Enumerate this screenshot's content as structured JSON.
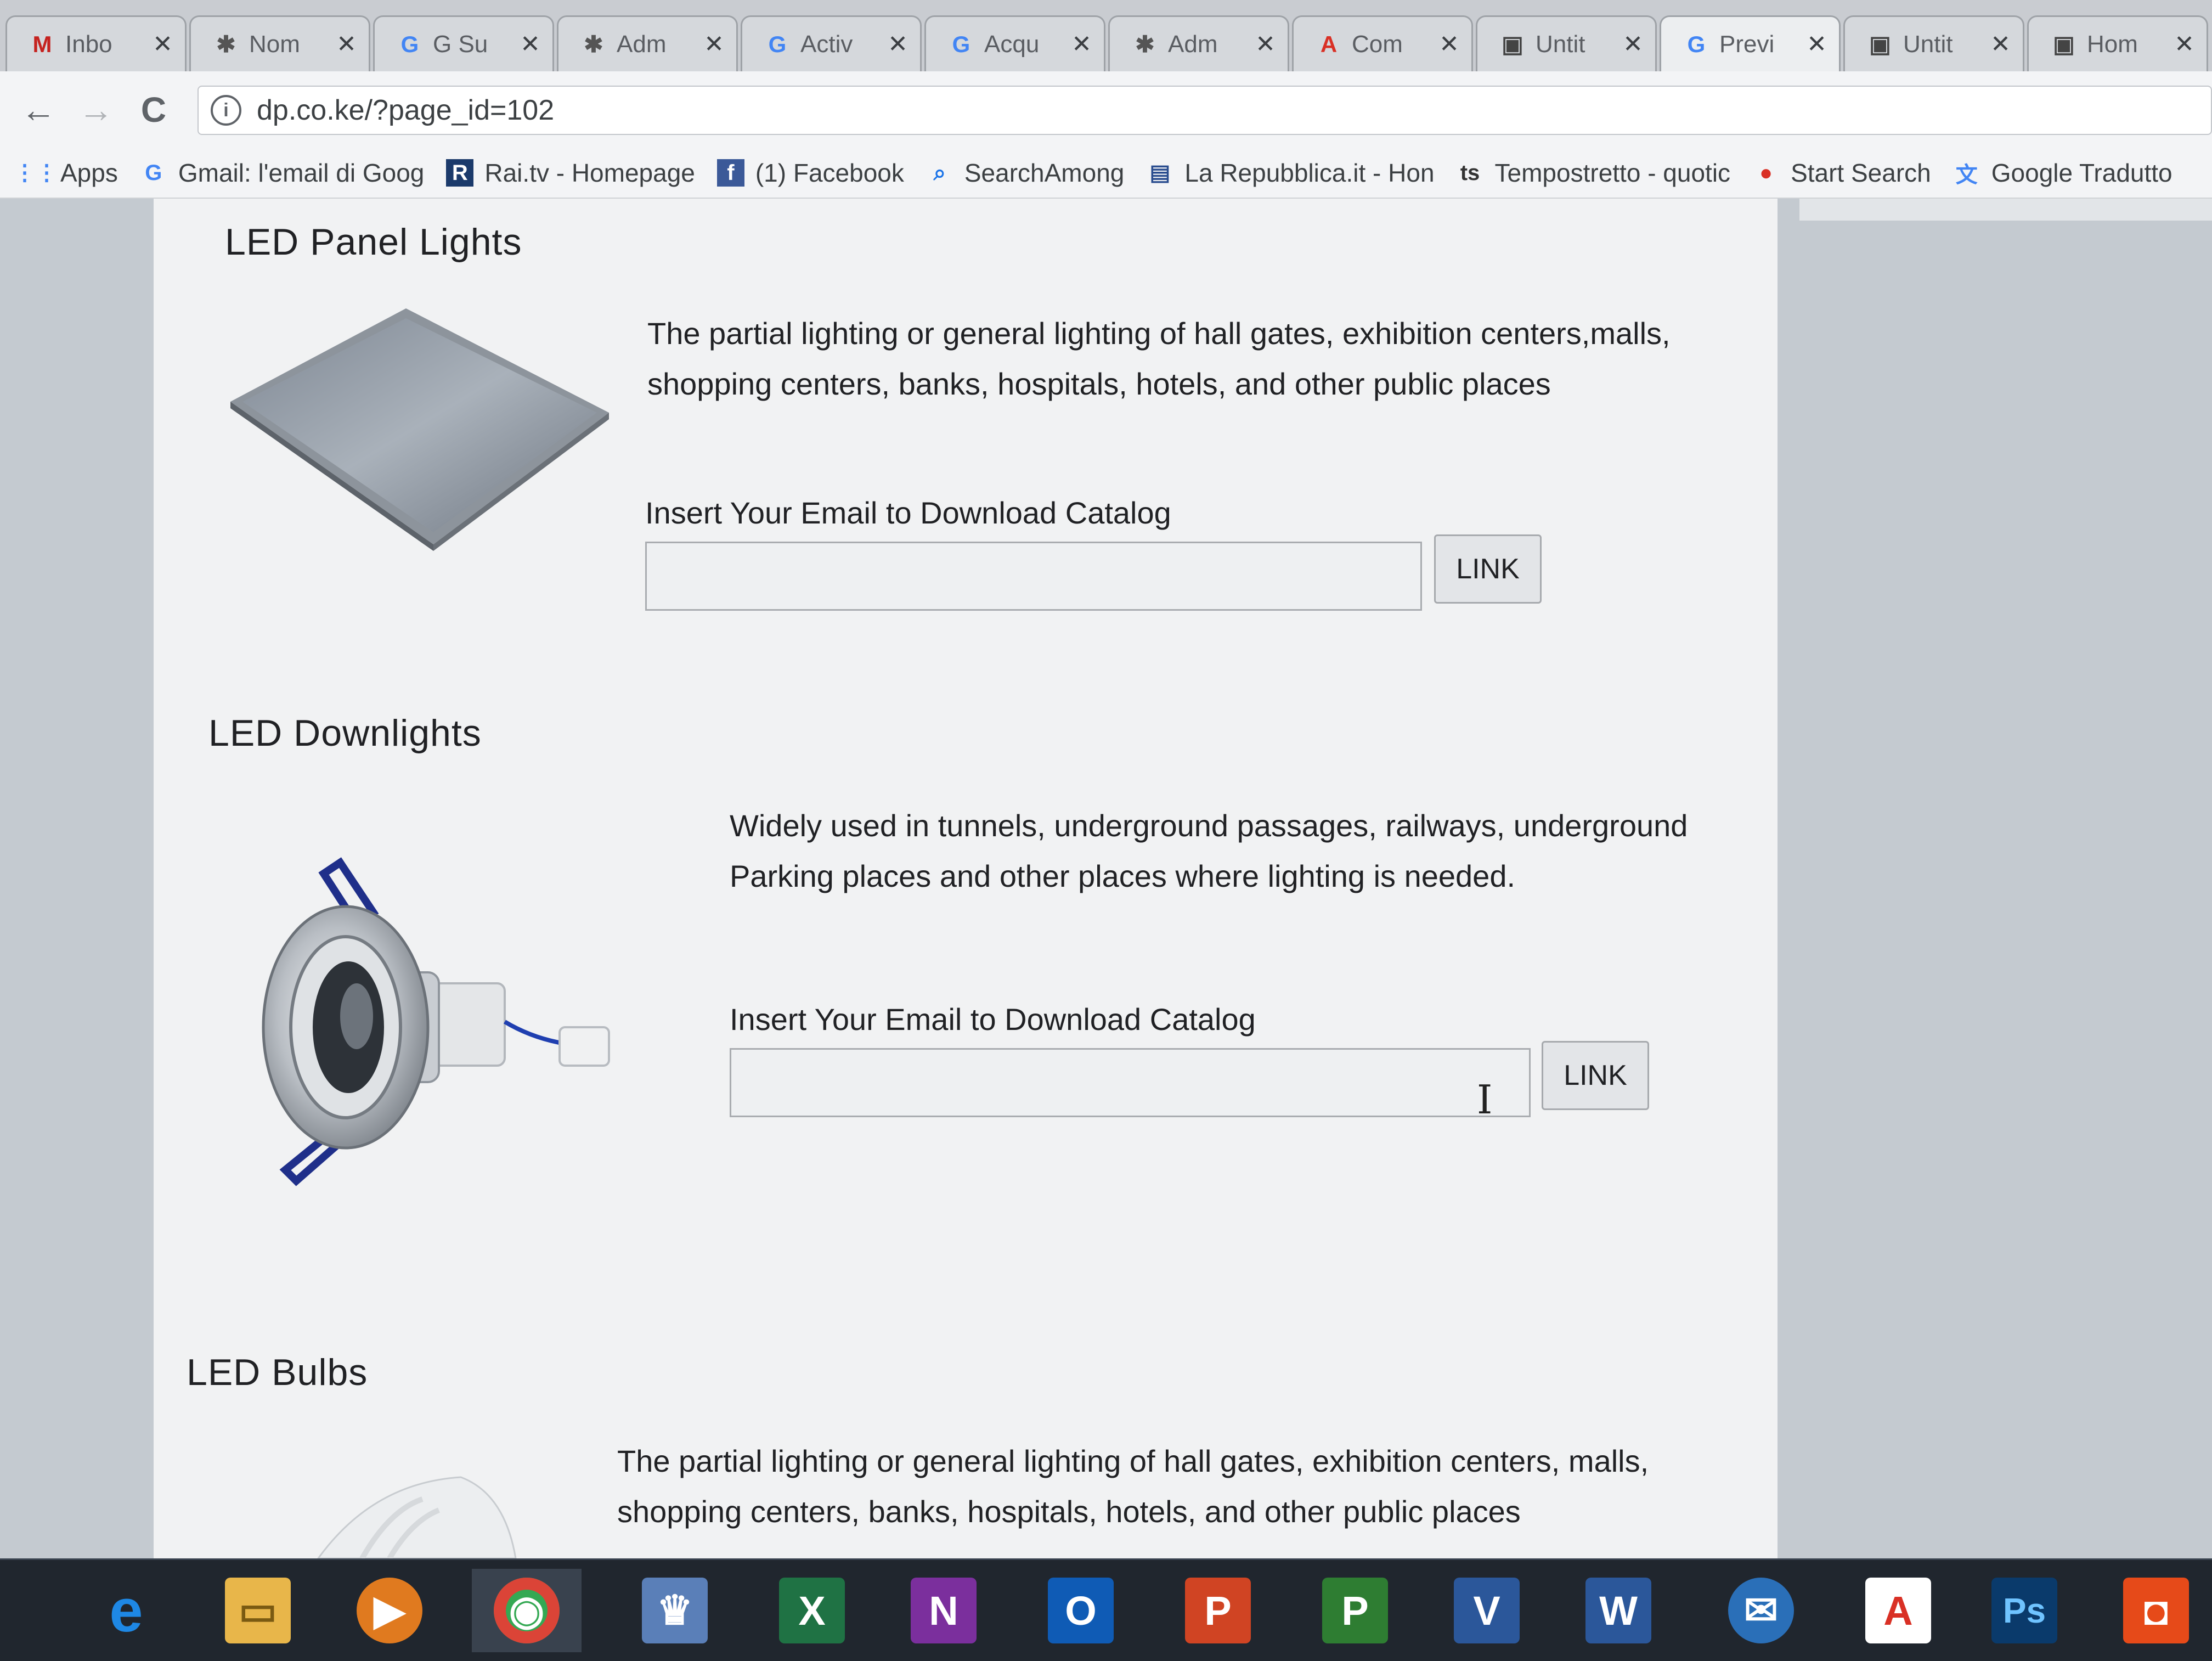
{
  "browser": {
    "tabs": [
      {
        "title": "Inbo",
        "icon": "gmail-icon",
        "glyph": "M",
        "color": "#c5221f"
      },
      {
        "title": "Nom",
        "icon": "plugin-icon",
        "glyph": "✱",
        "color": "#555555"
      },
      {
        "title": "G Su",
        "icon": "google-icon",
        "glyph": "G",
        "color": "#4285f4"
      },
      {
        "title": "Adm",
        "icon": "plugin-icon",
        "glyph": "✱",
        "color": "#555555"
      },
      {
        "title": "Activ",
        "icon": "google-icon",
        "glyph": "G",
        "color": "#4285f4"
      },
      {
        "title": "Acqu",
        "icon": "google-icon",
        "glyph": "G",
        "color": "#4285f4"
      },
      {
        "title": "Adm",
        "icon": "plugin-icon",
        "glyph": "✱",
        "color": "#555555"
      },
      {
        "title": "Com",
        "icon": "acrobat-icon",
        "glyph": "A",
        "color": "#d93025"
      },
      {
        "title": "Untit",
        "icon": "page-icon",
        "glyph": "▣",
        "color": "#444444"
      },
      {
        "title": "Previ",
        "icon": "google-icon",
        "glyph": "G",
        "color": "#4285f4"
      },
      {
        "title": "Untit",
        "icon": "page-icon",
        "glyph": "▣",
        "color": "#444444"
      },
      {
        "title": "Hom",
        "icon": "page-icon",
        "glyph": "▣",
        "color": "#444444"
      }
    ],
    "tab_close": "✕",
    "nav": {
      "back": "←",
      "forward": "→",
      "reload": "C"
    },
    "url": "dp.co.ke/?page_id=102",
    "bookmarks": [
      {
        "label": "Apps",
        "icon": "apps-grid-icon",
        "glyph": "⋮⋮",
        "color": "#4285f4"
      },
      {
        "label": "Gmail: l'email di Goog",
        "icon": "google-icon",
        "glyph": "G",
        "color": "#4285f4"
      },
      {
        "label": "Rai.tv - Homepage",
        "icon": "rai-icon",
        "glyph": "R",
        "color": "#1b3a6b"
      },
      {
        "label": "(1) Facebook",
        "icon": "facebook-icon",
        "glyph": "f",
        "color": "#3b5998"
      },
      {
        "label": "SearchAmong",
        "icon": "magnifier-icon",
        "glyph": "⌕",
        "color": "#1a73e8"
      },
      {
        "label": "La Repubblica.it - Hon",
        "icon": "newspaper-icon",
        "glyph": "▤",
        "color": "#2a4d8f"
      },
      {
        "label": "Tempostretto - quotic",
        "icon": "ts-icon",
        "glyph": "ts",
        "color": "#333333"
      },
      {
        "label": "Start Search",
        "icon": "search-bubble-icon",
        "glyph": "●",
        "color": "#d93025"
      },
      {
        "label": "Google Tradutto",
        "icon": "translate-icon",
        "glyph": "文",
        "color": "#4285f4"
      }
    ]
  },
  "page": {
    "sections": [
      {
        "title": "LED Panel Lights",
        "description": [
          "The partial lighting or general lighting of hall gates, exhibition centers,malls,",
          "shopping centers, banks, hospitals, hotels, and other public places"
        ],
        "email_label": "Insert Your Email to Download Catalog",
        "button": "LINK"
      },
      {
        "title": "LED Downlights",
        "description": [
          "Widely used in tunnels, underground passages, railways, underground",
          "Parking places and other places where lighting is needed."
        ],
        "email_label": "Insert Your Email to Download Catalog",
        "button": "LINK"
      },
      {
        "title": "LED Bulbs",
        "description": [
          "The partial lighting or general lighting of hall gates, exhibition centers, malls,",
          "shopping centers, banks, hospitals, hotels, and other public places"
        ]
      }
    ]
  },
  "taskbar": {
    "apps": [
      {
        "name": "Internet Explorer",
        "icon": "ie-icon",
        "glyph": "e",
        "color": "#1e88e5"
      },
      {
        "name": "File Explorer",
        "icon": "folder-icon",
        "glyph": "▭",
        "color": "#e8b64a"
      },
      {
        "name": "Media Player",
        "icon": "media-player-icon",
        "glyph": "▶",
        "color": "#e07a1f"
      },
      {
        "name": "Chrome",
        "icon": "chrome-icon",
        "glyph": "◉",
        "color": "#34a853"
      },
      {
        "name": "Store",
        "icon": "store-icon",
        "glyph": "♛",
        "color": "#5a7fb8"
      },
      {
        "name": "Excel",
        "icon": "excel-icon",
        "glyph": "X",
        "color": "#1f7244"
      },
      {
        "name": "OneNote",
        "icon": "onenote-icon",
        "glyph": "N",
        "color": "#7b2f9d"
      },
      {
        "name": "Outlook",
        "icon": "outlook-icon",
        "glyph": "O",
        "color": "#0f5bb5"
      },
      {
        "name": "PowerPoint",
        "icon": "powerpoint-icon",
        "glyph": "P",
        "color": "#d04423"
      },
      {
        "name": "Project",
        "icon": "project-icon",
        "glyph": "P",
        "color": "#2e7d32"
      },
      {
        "name": "Visio",
        "icon": "visio-icon",
        "glyph": "V",
        "color": "#2b579a"
      },
      {
        "name": "Word",
        "icon": "word-icon",
        "glyph": "W",
        "color": "#2b579a"
      },
      {
        "name": "Thunderbird",
        "icon": "thunderbird-icon",
        "glyph": "✉",
        "color": "#2a6fb8"
      },
      {
        "name": "Acrobat Reader",
        "icon": "acrobat-icon",
        "glyph": "A",
        "color": "#d93025"
      },
      {
        "name": "Photoshop",
        "icon": "photoshop-icon",
        "glyph": "Ps",
        "color": "#0a3a6b"
      },
      {
        "name": "Office",
        "icon": "office-icon",
        "glyph": "◘",
        "color": "#e64a19"
      }
    ]
  }
}
